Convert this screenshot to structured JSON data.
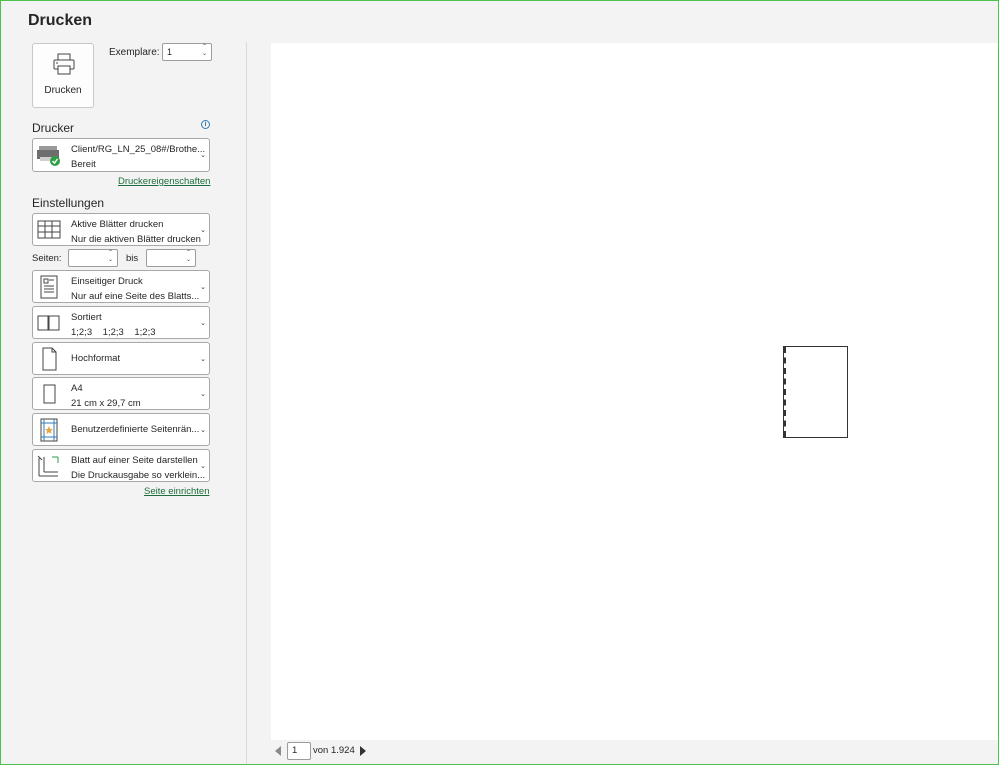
{
  "title": "Drucken",
  "print_button": {
    "label": "Drucken"
  },
  "copies": {
    "label": "Exemplare:",
    "value": "1"
  },
  "printer": {
    "heading": "Drucker",
    "name": "Client/RG_LN_25_08#/Brothe...",
    "status": "Bereit",
    "properties_link": "Druckereigenschaften"
  },
  "settings": {
    "heading": "Einstellungen",
    "scope": {
      "title": "Aktive Blätter drucken",
      "subtitle": "Nur die aktiven Blätter drucken"
    },
    "pages_label": "Seiten:",
    "pages_from": "",
    "pages_to_label": "bis",
    "pages_to": "",
    "sides": {
      "title": "Einseitiger Druck",
      "subtitle": "Nur auf eine Seite des Blatts..."
    },
    "collate": {
      "title": "Sortiert",
      "subtitle": "1;2;3    1;2;3    1;2;3"
    },
    "orientation": {
      "title": "Hochformat"
    },
    "paper": {
      "title": "A4",
      "subtitle": "21 cm x 29,7 cm"
    },
    "margins": {
      "title": "Benutzerdefinierte Seitenrän..."
    },
    "scaling": {
      "title": "Blatt auf einer Seite darstellen",
      "subtitle": "Die Druckausgabe so verklein..."
    },
    "page_setup_link": "Seite einrichten"
  },
  "navigation": {
    "current_page": "1",
    "of_text": "von 1.924"
  }
}
